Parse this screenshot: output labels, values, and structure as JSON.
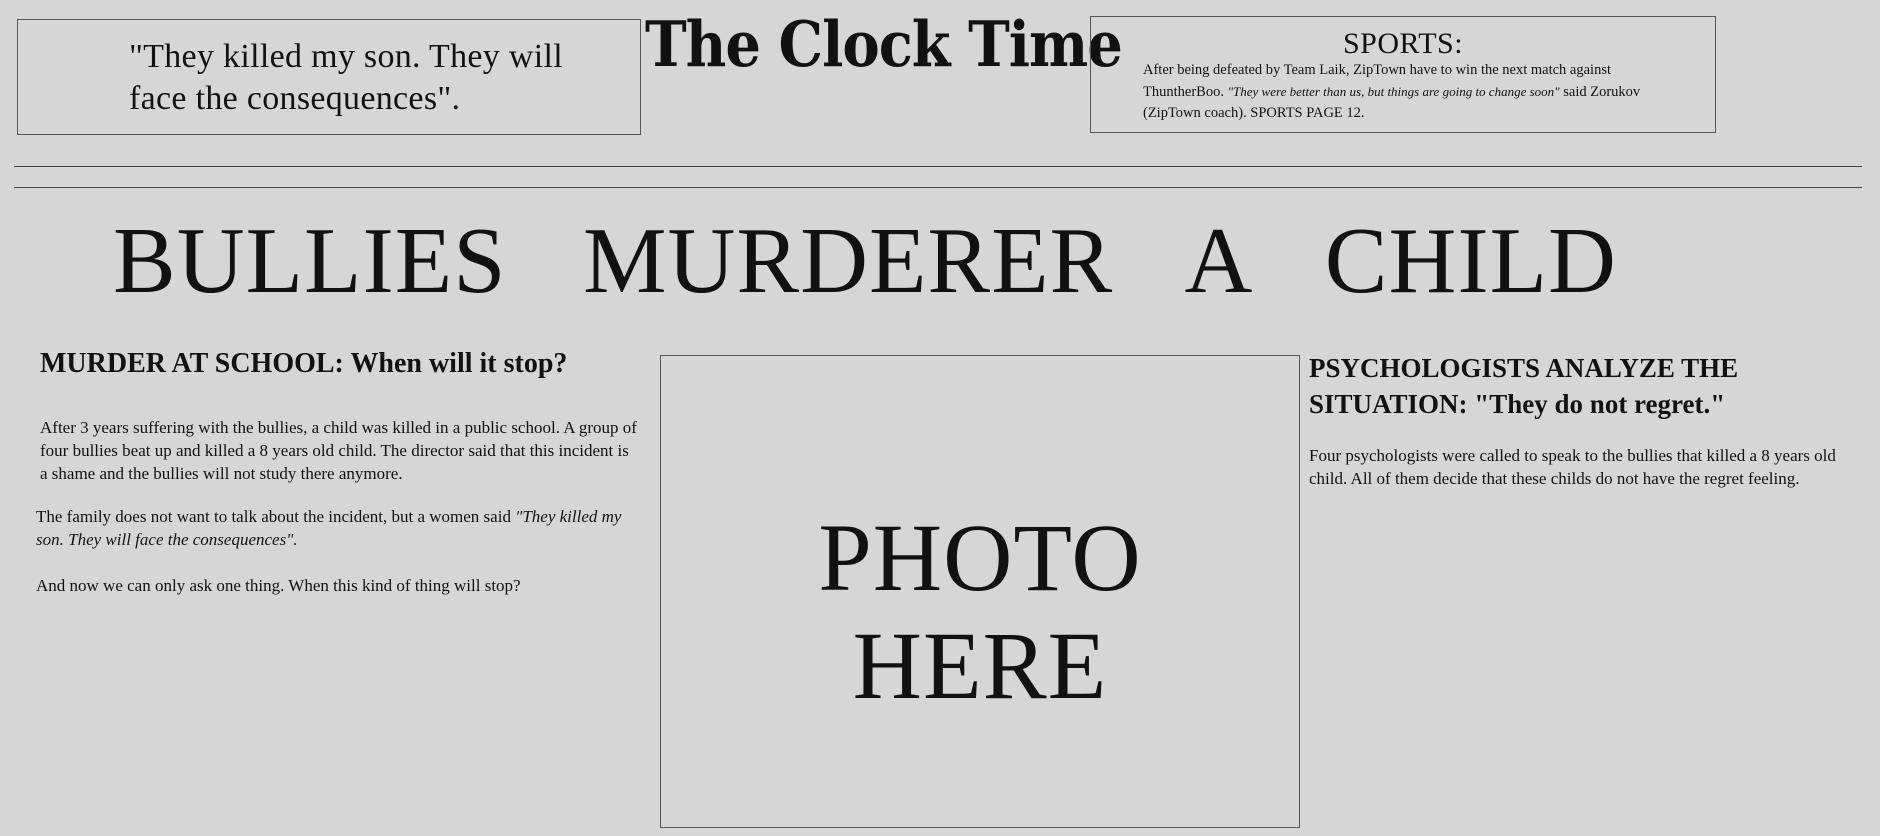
{
  "header": {
    "quote_box": "\"They killed my son. They will face the consequences\".",
    "masthead": "The Clock Time",
    "sports": {
      "title": "SPORTS:",
      "body_part1": "After being defeated by Team Laik, ZipTown have to win the next match against ThuntherBoo. ",
      "body_quote": "\"They were better than us, but things are going to change soon\"",
      "body_part2": " said Zorukov (ZipTown coach). SPORTS PAGE 12."
    }
  },
  "headline": "BULLIES MURDERER A CHILD",
  "left_article": {
    "title": "MURDER AT SCHOOL: When will it stop?",
    "p1": "After 3 years suffering with the bullies, a child was killed in a public school. A group of four bullies beat up and killed a 8 years old child. The director said that this incident is a shame and the bullies will not study there anymore.",
    "p2_text": "The family does not want to talk about the incident, but a women said ",
    "p2_quote": "\"They killed my son. They will face the consequences\".",
    "p3": "And now we can only ask one thing. When this kind of thing will stop?"
  },
  "photo": {
    "line1": "PHOTO",
    "line2": "HERE"
  },
  "right_article": {
    "title": "PSYCHOLOGISTS ANALYZE THE SITUATION: \"They do not regret.\"",
    "p1": "Four psychologists were called to speak to the bullies that killed a 8 years old child. All of them decide that these childs do not have the regret feeling."
  }
}
